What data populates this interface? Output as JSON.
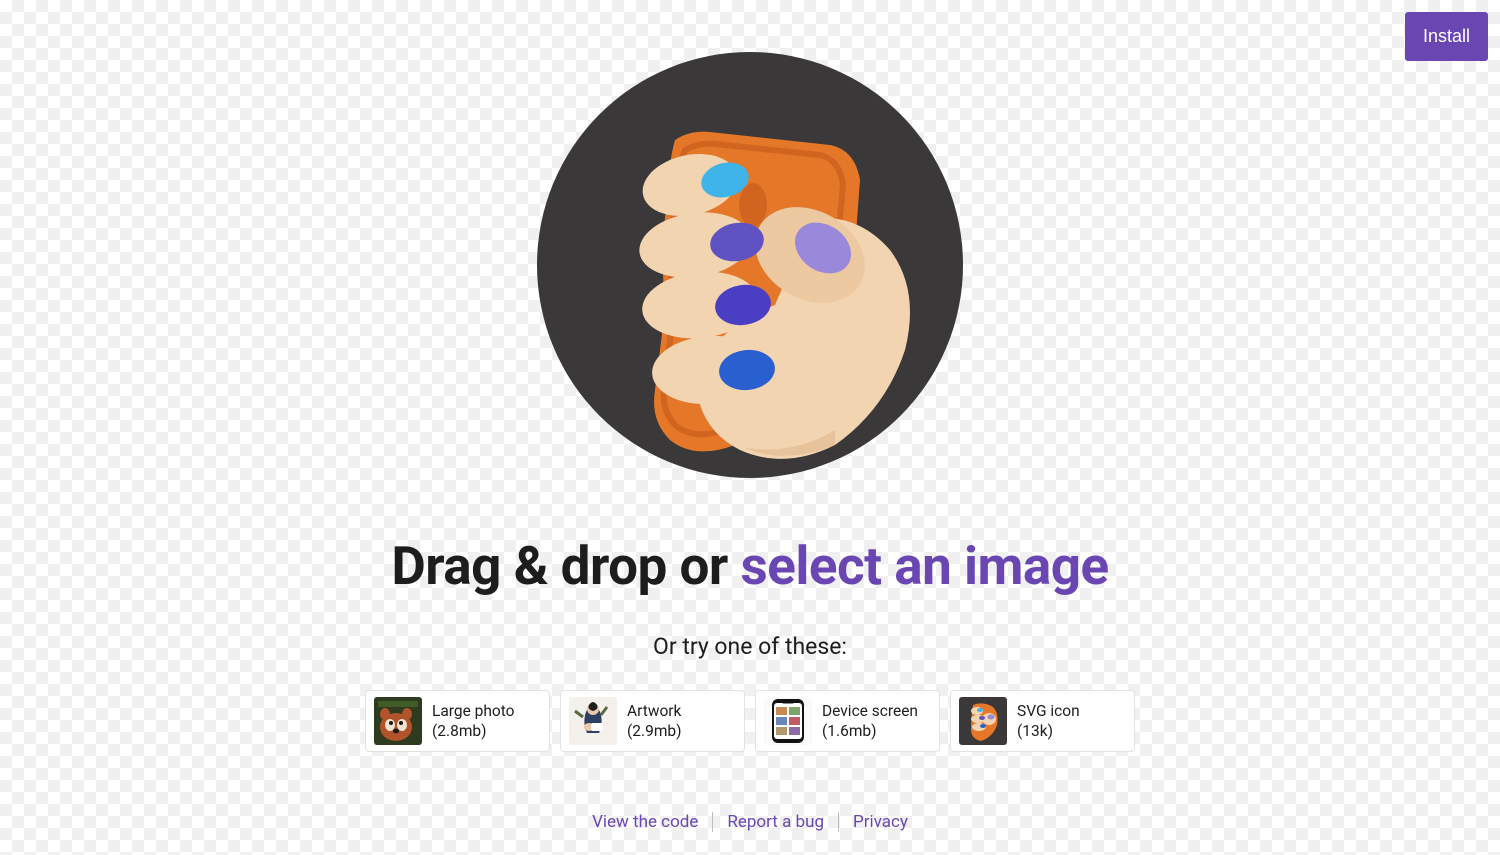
{
  "install_button_label": "Install",
  "headline": {
    "prefix": "Drag & drop or ",
    "link_text": "select an image"
  },
  "subhead": "Or try one of these:",
  "examples": [
    {
      "label": "Large photo",
      "size": "(2.8mb)",
      "thumb": "red-panda-photo"
    },
    {
      "label": "Artwork",
      "size": "(2.9mb)",
      "thumb": "artwork-person"
    },
    {
      "label": "Device screen",
      "size": "(1.6mb)",
      "thumb": "phone-screenshot"
    },
    {
      "label": "SVG icon",
      "size": "(13k)",
      "thumb": "squoosh-logo"
    }
  ],
  "footer_links": [
    {
      "label": "View the code"
    },
    {
      "label": "Report a bug"
    },
    {
      "label": "Privacy"
    }
  ]
}
